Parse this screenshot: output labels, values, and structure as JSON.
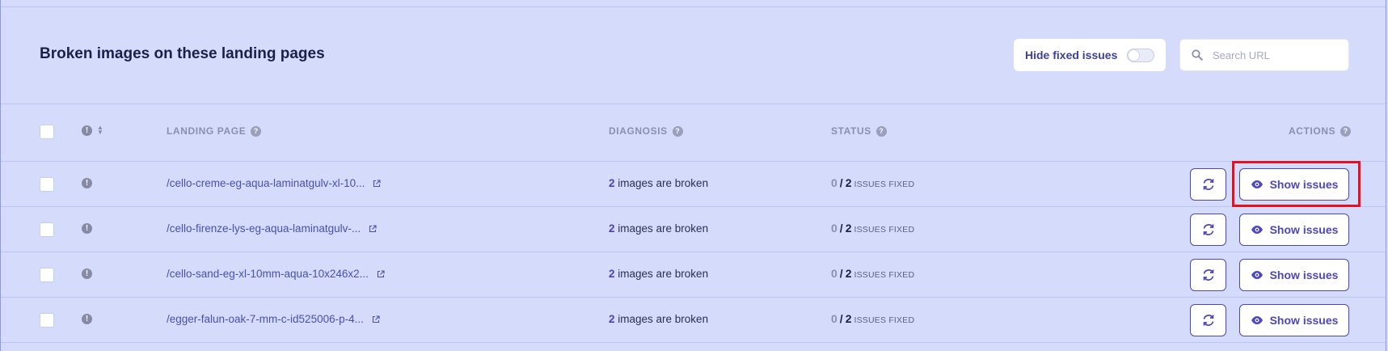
{
  "header": {
    "title": "Broken images on these landing pages",
    "toggle_label": "Hide fixed issues",
    "toggle_on": false,
    "search_placeholder": "Search URL"
  },
  "columns": {
    "landing_page": "LANDING PAGE",
    "diagnosis": "DIAGNOSIS",
    "status": "STATUS",
    "actions": "ACTIONS"
  },
  "rows": [
    {
      "url": "/cello-creme-eg-aqua-laminatgulv-xl-10...",
      "count": "2",
      "diag_text": " images are broken",
      "fixed": "0",
      "total": "2",
      "fixed_label": "ISSUES FIXED",
      "action_label": "Show issues"
    },
    {
      "url": "/cello-firenze-lys-eg-aqua-laminatgulv-...",
      "count": "2",
      "diag_text": " images are broken",
      "fixed": "0",
      "total": "2",
      "fixed_label": "ISSUES FIXED",
      "action_label": "Show issues"
    },
    {
      "url": "/cello-sand-eg-xl-10mm-aqua-10x246x2...",
      "count": "2",
      "diag_text": " images are broken",
      "fixed": "0",
      "total": "2",
      "fixed_label": "ISSUES FIXED",
      "action_label": "Show issues"
    },
    {
      "url": "/egger-falun-oak-7-mm-c-id525006-p-4...",
      "count": "2",
      "diag_text": " images are broken",
      "fixed": "0",
      "total": "2",
      "fixed_label": "ISSUES FIXED",
      "action_label": "Show issues"
    }
  ],
  "colors": {
    "accent": "#4d46bf",
    "highlight": "#e8101f",
    "background": "#d5dcfb"
  }
}
